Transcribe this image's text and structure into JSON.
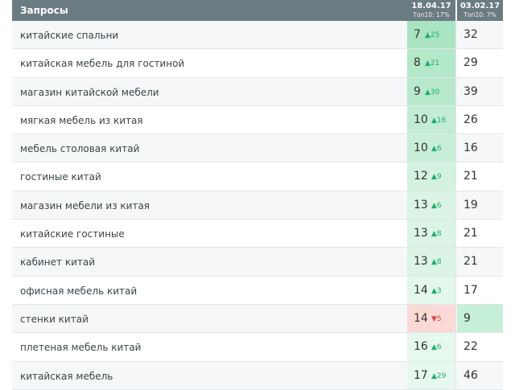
{
  "header": {
    "queries_label": "Запросы",
    "col1_date": "18.04.17",
    "col1_sub": "Топ10: 17%",
    "col2_date": "03.02.17",
    "col2_sub": "Топ10: 7%"
  },
  "rows": [
    {
      "keyword": "китайские спальни",
      "pos": "7",
      "delta": "▲25",
      "prev": "32"
    },
    {
      "keyword": "китайская мебель для гостиной",
      "pos": "8",
      "delta": "▲21",
      "prev": "29"
    },
    {
      "keyword": "магазин китайской мебели",
      "pos": "9",
      "delta": "▲30",
      "prev": "39"
    },
    {
      "keyword": "мягкая мебель из китая",
      "pos": "10",
      "delta": "▲16",
      "prev": "26"
    },
    {
      "keyword": "мебель столовая китай",
      "pos": "10",
      "delta": "▲6",
      "prev": "16"
    },
    {
      "keyword": "гостиные китай",
      "pos": "12",
      "delta": "▲9",
      "prev": "21"
    },
    {
      "keyword": "магазин мебели из китая",
      "pos": "13",
      "delta": "▲6",
      "prev": "19"
    },
    {
      "keyword": "китайские гостиные",
      "pos": "13",
      "delta": "▲8",
      "prev": "21"
    },
    {
      "keyword": "кабинет китай",
      "pos": "13",
      "delta": "▲8",
      "prev": "21"
    },
    {
      "keyword": "офисная мебель китай",
      "pos": "14",
      "delta": "▲3",
      "prev": "17"
    },
    {
      "keyword": "стенки китай",
      "pos": "14",
      "delta": "▼5",
      "prev": "9"
    },
    {
      "keyword": "плетеная мебель китай",
      "pos": "16",
      "delta": "▲6",
      "prev": "22"
    },
    {
      "keyword": "китайская мебель",
      "pos": "17",
      "delta": "▲29",
      "prev": "46"
    }
  ],
  "colors": {
    "header_bg": "#6b7b82",
    "pos_green_strong": "#a9e3c2",
    "pos_green_mid": "#c2ecd4",
    "pos_green_light": "#dbf4e5",
    "pos_red": "#fbd9d7",
    "prev_green": "#c5efd6",
    "delta_up": "#1fae6a",
    "delta_down": "#e0453d"
  }
}
